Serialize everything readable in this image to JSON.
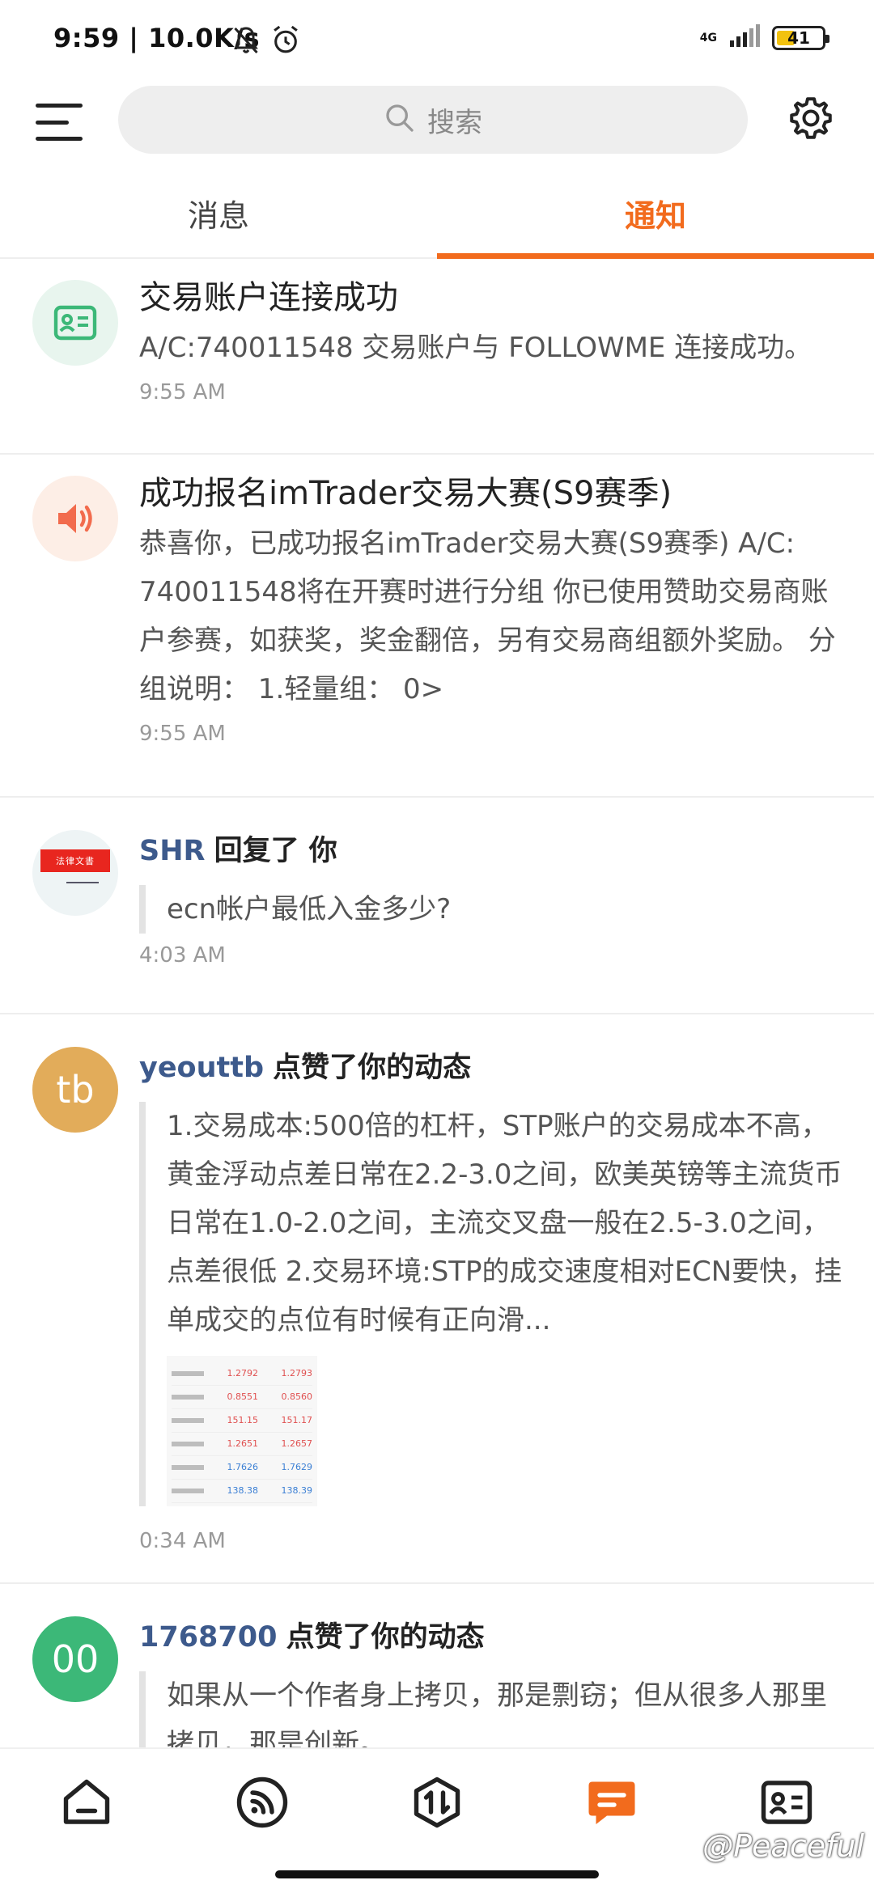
{
  "status_bar": {
    "text": "9:59 | 10.0K/s",
    "network": "4G",
    "battery": 41,
    "battery_label": "41"
  },
  "top_bar": {
    "search_placeholder": "搜索"
  },
  "tabs": [
    {
      "label": "消息",
      "active": false
    },
    {
      "label": "通知",
      "active": true
    }
  ],
  "notifications": [
    {
      "icon": "id-card-icon",
      "title": "交易账户连接成功",
      "body": "A/C:740011548 交易账户与 FOLLOWME 连接成功。",
      "time": "9:55 AM"
    },
    {
      "icon": "speaker-icon",
      "title": "成功报名imTrader交易大赛(S9赛季)",
      "body": "恭喜你，已成功报名imTrader交易大赛(S9赛季) A/C: 740011548将在开赛时进行分组 你已使用赞助交易商账户参赛，如获奖，奖金翻倍，另有交易商组额外奖励。 分组说明： 1.轻量组： 0>",
      "time": "9:55 AM"
    },
    {
      "avatar_text": "法律文書",
      "user": "SHR",
      "action": "回复了 你",
      "quote": "ecn帐户最低入金多少?",
      "time": "4:03 AM"
    },
    {
      "avatar_text": "tb",
      "avatar_color": "#e2ac5a",
      "user": "yeouttb",
      "action": "点赞了你的动态",
      "quote": "1.交易成本:500倍的杠杆，STP账户的交易成本不高，黄金浮动点差日常在2.2-3.0之间，欧美英镑等主流货币日常在1.0-2.0之间，主流交叉盘一般在2.5-3.0之间，点差很低 2.交易环境:STP的成交速度相对ECN要快，挂单成交的点位有时候有正向滑...",
      "thumb_quotes": [
        {
          "bid": "1.2792",
          "ask": "1.2793",
          "color": "red"
        },
        {
          "bid": "0.8551",
          "ask": "0.8560",
          "color": "red"
        },
        {
          "bid": "151.15",
          "ask": "151.17",
          "color": "red"
        },
        {
          "bid": "1.2651",
          "ask": "1.2657",
          "color": "red"
        },
        {
          "bid": "1.7626",
          "ask": "1.7629",
          "color": "blue"
        },
        {
          "bid": "138.38",
          "ask": "138.39",
          "color": "blue"
        }
      ],
      "time": "0:34 AM"
    },
    {
      "avatar_text": "00",
      "avatar_color": "#3cb878",
      "user": "1768700",
      "action": "点赞了你的动态",
      "quote": "如果从一个作者身上拷贝，那是剽窃；但从很多人那里拷贝，那是创新。"
    }
  ],
  "watermark": "@Peaceful",
  "bottom_nav": [
    {
      "icon": "home-icon",
      "active": false
    },
    {
      "icon": "feed-icon",
      "active": false
    },
    {
      "icon": "trade-icon",
      "active": false
    },
    {
      "icon": "message-icon",
      "active": true
    },
    {
      "icon": "profile-card-icon",
      "active": false
    }
  ],
  "colors": {
    "accent": "#f26b1d",
    "username": "#3d5a8c",
    "divider": "#eeeeee"
  }
}
